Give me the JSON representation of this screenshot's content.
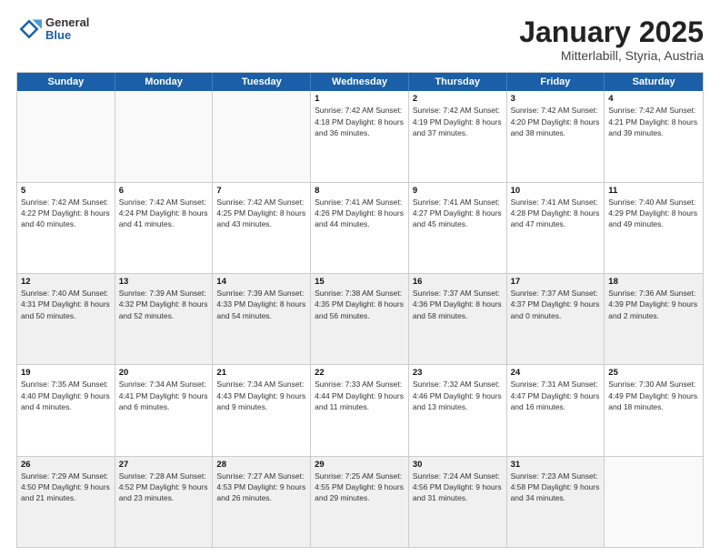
{
  "header": {
    "logo_general": "General",
    "logo_blue": "Blue",
    "month_title": "January 2025",
    "location": "Mitterlabill, Styria, Austria"
  },
  "weekdays": [
    "Sunday",
    "Monday",
    "Tuesday",
    "Wednesday",
    "Thursday",
    "Friday",
    "Saturday"
  ],
  "rows": [
    [
      {
        "day": "",
        "text": "",
        "empty": true
      },
      {
        "day": "",
        "text": "",
        "empty": true
      },
      {
        "day": "",
        "text": "",
        "empty": true
      },
      {
        "day": "1",
        "text": "Sunrise: 7:42 AM\nSunset: 4:18 PM\nDaylight: 8 hours and 36 minutes."
      },
      {
        "day": "2",
        "text": "Sunrise: 7:42 AM\nSunset: 4:19 PM\nDaylight: 8 hours and 37 minutes."
      },
      {
        "day": "3",
        "text": "Sunrise: 7:42 AM\nSunset: 4:20 PM\nDaylight: 8 hours and 38 minutes."
      },
      {
        "day": "4",
        "text": "Sunrise: 7:42 AM\nSunset: 4:21 PM\nDaylight: 8 hours and 39 minutes."
      }
    ],
    [
      {
        "day": "5",
        "text": "Sunrise: 7:42 AM\nSunset: 4:22 PM\nDaylight: 8 hours and 40 minutes."
      },
      {
        "day": "6",
        "text": "Sunrise: 7:42 AM\nSunset: 4:24 PM\nDaylight: 8 hours and 41 minutes."
      },
      {
        "day": "7",
        "text": "Sunrise: 7:42 AM\nSunset: 4:25 PM\nDaylight: 8 hours and 43 minutes."
      },
      {
        "day": "8",
        "text": "Sunrise: 7:41 AM\nSunset: 4:26 PM\nDaylight: 8 hours and 44 minutes."
      },
      {
        "day": "9",
        "text": "Sunrise: 7:41 AM\nSunset: 4:27 PM\nDaylight: 8 hours and 45 minutes."
      },
      {
        "day": "10",
        "text": "Sunrise: 7:41 AM\nSunset: 4:28 PM\nDaylight: 8 hours and 47 minutes."
      },
      {
        "day": "11",
        "text": "Sunrise: 7:40 AM\nSunset: 4:29 PM\nDaylight: 8 hours and 49 minutes."
      }
    ],
    [
      {
        "day": "12",
        "text": "Sunrise: 7:40 AM\nSunset: 4:31 PM\nDaylight: 8 hours and 50 minutes.",
        "shaded": true
      },
      {
        "day": "13",
        "text": "Sunrise: 7:39 AM\nSunset: 4:32 PM\nDaylight: 8 hours and 52 minutes.",
        "shaded": true
      },
      {
        "day": "14",
        "text": "Sunrise: 7:39 AM\nSunset: 4:33 PM\nDaylight: 8 hours and 54 minutes.",
        "shaded": true
      },
      {
        "day": "15",
        "text": "Sunrise: 7:38 AM\nSunset: 4:35 PM\nDaylight: 8 hours and 56 minutes.",
        "shaded": true
      },
      {
        "day": "16",
        "text": "Sunrise: 7:37 AM\nSunset: 4:36 PM\nDaylight: 8 hours and 58 minutes.",
        "shaded": true
      },
      {
        "day": "17",
        "text": "Sunrise: 7:37 AM\nSunset: 4:37 PM\nDaylight: 9 hours and 0 minutes.",
        "shaded": true
      },
      {
        "day": "18",
        "text": "Sunrise: 7:36 AM\nSunset: 4:39 PM\nDaylight: 9 hours and 2 minutes.",
        "shaded": true
      }
    ],
    [
      {
        "day": "19",
        "text": "Sunrise: 7:35 AM\nSunset: 4:40 PM\nDaylight: 9 hours and 4 minutes."
      },
      {
        "day": "20",
        "text": "Sunrise: 7:34 AM\nSunset: 4:41 PM\nDaylight: 9 hours and 6 minutes."
      },
      {
        "day": "21",
        "text": "Sunrise: 7:34 AM\nSunset: 4:43 PM\nDaylight: 9 hours and 9 minutes."
      },
      {
        "day": "22",
        "text": "Sunrise: 7:33 AM\nSunset: 4:44 PM\nDaylight: 9 hours and 11 minutes."
      },
      {
        "day": "23",
        "text": "Sunrise: 7:32 AM\nSunset: 4:46 PM\nDaylight: 9 hours and 13 minutes."
      },
      {
        "day": "24",
        "text": "Sunrise: 7:31 AM\nSunset: 4:47 PM\nDaylight: 9 hours and 16 minutes."
      },
      {
        "day": "25",
        "text": "Sunrise: 7:30 AM\nSunset: 4:49 PM\nDaylight: 9 hours and 18 minutes."
      }
    ],
    [
      {
        "day": "26",
        "text": "Sunrise: 7:29 AM\nSunset: 4:50 PM\nDaylight: 9 hours and 21 minutes.",
        "shaded": true
      },
      {
        "day": "27",
        "text": "Sunrise: 7:28 AM\nSunset: 4:52 PM\nDaylight: 9 hours and 23 minutes.",
        "shaded": true
      },
      {
        "day": "28",
        "text": "Sunrise: 7:27 AM\nSunset: 4:53 PM\nDaylight: 9 hours and 26 minutes.",
        "shaded": true
      },
      {
        "day": "29",
        "text": "Sunrise: 7:25 AM\nSunset: 4:55 PM\nDaylight: 9 hours and 29 minutes.",
        "shaded": true
      },
      {
        "day": "30",
        "text": "Sunrise: 7:24 AM\nSunset: 4:56 PM\nDaylight: 9 hours and 31 minutes.",
        "shaded": true
      },
      {
        "day": "31",
        "text": "Sunrise: 7:23 AM\nSunset: 4:58 PM\nDaylight: 9 hours and 34 minutes.",
        "shaded": true
      },
      {
        "day": "",
        "text": "",
        "empty": true,
        "shaded": true
      }
    ]
  ]
}
